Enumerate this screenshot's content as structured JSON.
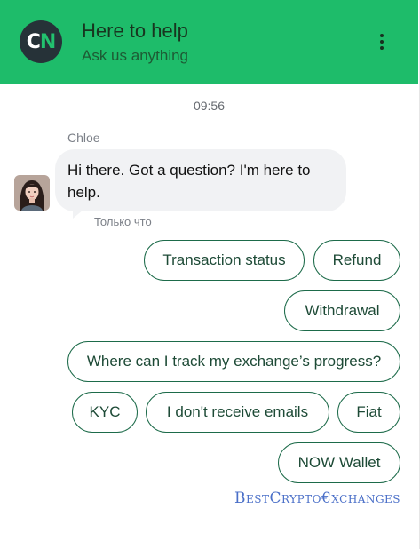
{
  "header": {
    "logo_c": "C",
    "logo_n": "N",
    "title": "Here to help",
    "subtitle": "Ask us anything",
    "menu_icon": "more-vertical-icon",
    "background_color": "#1ebc6a"
  },
  "chat": {
    "timestamp": "09:56",
    "sender_name": "Chloe",
    "message": "Hi there. Got a question? I'm here to help.",
    "message_meta": "Только что"
  },
  "quick_replies": [
    "Transaction status",
    "Refund",
    "Withdrawal",
    "Where can I track my exchange’s progress?",
    "KYC",
    "I don't receive emails",
    "Fiat",
    "NOW Wallet"
  ],
  "watermark": "BestCrypto€xchanges",
  "colors": {
    "accent": "#1ebc6a",
    "button_border": "#1d6b4a",
    "bubble_bg": "#f1f2f4"
  }
}
